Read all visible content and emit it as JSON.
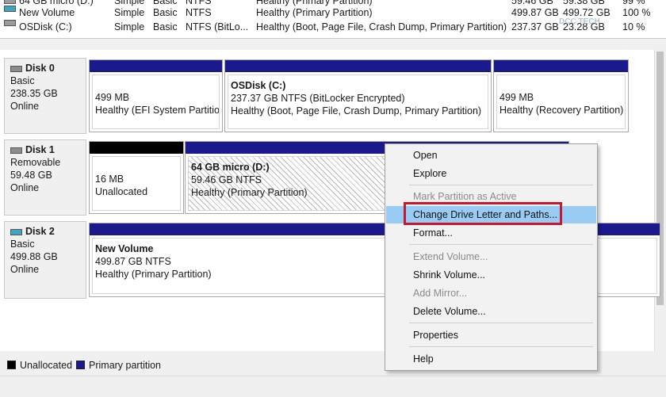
{
  "volumes": [
    {
      "name": "64 GB micro (D:)",
      "layout": "Simple",
      "type": "Basic",
      "fs": "NTFS",
      "status": "Healthy (Primary Partition)",
      "capacity": "59.46 GB",
      "free": "59.38 GB",
      "pct": "99 %"
    },
    {
      "name": "New Volume",
      "layout": "Simple",
      "type": "Basic",
      "fs": "NTFS",
      "status": "Healthy (Primary Partition)",
      "capacity": "499.87 GB",
      "free": "499.72 GB",
      "pct": "100 %"
    },
    {
      "name": "OSDisk (C:)",
      "layout": "Simple",
      "type": "Basic",
      "fs": "NTFS (BitLo...",
      "status": "Healthy (Boot, Page File, Crash Dump, Primary Partition)",
      "capacity": "237.37 GB",
      "free": "23.28 GB",
      "pct": "10 %"
    }
  ],
  "watermark": "DCC TECH",
  "disks": [
    {
      "name": "Disk 0",
      "type": "Basic",
      "size": "238.35 GB",
      "state": "Online",
      "partitions": [
        {
          "title": "",
          "size": "499 MB",
          "status": "Healthy (EFI System Partition)"
        },
        {
          "title": "OSDisk  (C:)",
          "size": "237.37 GB NTFS (BitLocker Encrypted)",
          "status": "Healthy (Boot, Page File, Crash Dump, Primary Partition)"
        },
        {
          "title": "",
          "size": "499 MB",
          "status": "Healthy (Recovery Partition)"
        }
      ]
    },
    {
      "name": "Disk 1",
      "type": "Removable",
      "size": "59.48 GB",
      "state": "Online",
      "partitions": [
        {
          "title": "",
          "size": "16 MB",
          "status": "Unallocated"
        },
        {
          "title": "64 GB micro  (D:)",
          "size": "59.46 GB NTFS",
          "status": "Healthy (Primary Partition)"
        }
      ]
    },
    {
      "name": "Disk 2",
      "type": "Basic",
      "size": "499.88 GB",
      "state": "Online",
      "partitions": [
        {
          "title": "New Volume",
          "size": "499.87 GB NTFS",
          "status": "Healthy (Primary Partition)"
        }
      ]
    }
  ],
  "context_menu": {
    "open": "Open",
    "explore": "Explore",
    "mark_active": "Mark Partition as Active",
    "change_letter": "Change Drive Letter and Paths...",
    "format": "Format...",
    "extend": "Extend Volume...",
    "shrink": "Shrink Volume...",
    "add_mirror": "Add Mirror...",
    "delete": "Delete Volume...",
    "properties": "Properties",
    "help": "Help"
  },
  "legend": {
    "unallocated": "Unallocated",
    "primary": "Primary partition"
  },
  "colors": {
    "primary": "#1a1a8c",
    "unallocated": "#000000",
    "highlight": "#99ccf5",
    "callout": "#c7182d"
  }
}
